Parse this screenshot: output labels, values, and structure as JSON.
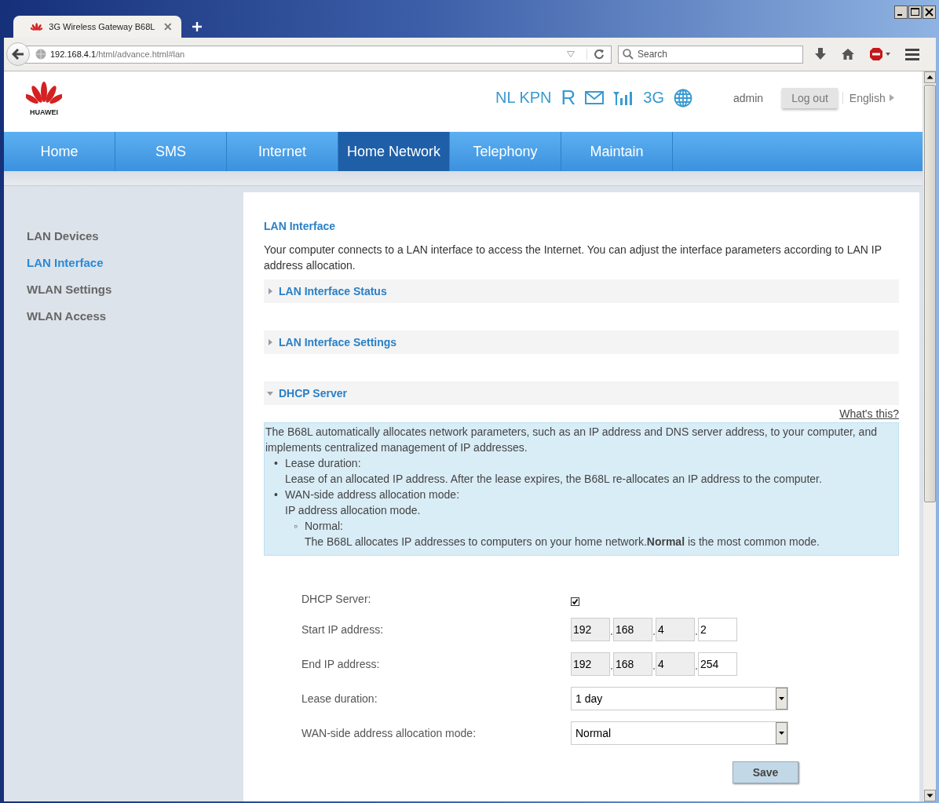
{
  "browser": {
    "tab_title": "3G Wireless Gateway B68L",
    "url_host": "192.168.4.1",
    "url_path": "/html/advance.html#lan",
    "search_placeholder": "Search"
  },
  "header": {
    "operator": "NL KPN",
    "roaming": "R",
    "network_type": "3G",
    "user": "admin",
    "logout": "Log out",
    "language": "English",
    "logo_text": "HUAWEI"
  },
  "menu": [
    {
      "label": "Home",
      "selected": false
    },
    {
      "label": "SMS",
      "selected": false
    },
    {
      "label": "Internet",
      "selected": false
    },
    {
      "label": "Home Network",
      "selected": true
    },
    {
      "label": "Telephony",
      "selected": false
    },
    {
      "label": "Maintain",
      "selected": false
    }
  ],
  "sidebar": {
    "items": [
      {
        "label": "LAN Devices",
        "selected": false
      },
      {
        "label": "LAN Interface",
        "selected": true
      },
      {
        "label": "WLAN Settings",
        "selected": false
      },
      {
        "label": "WLAN Access",
        "selected": false
      }
    ]
  },
  "content": {
    "title": "LAN Interface",
    "intro": "Your computer connects to a LAN interface to access the Internet. You can adjust the interface parameters according to LAN IP address allocation.",
    "sections": [
      {
        "label": "LAN Interface Status",
        "expanded": false
      },
      {
        "label": "LAN Interface Settings",
        "expanded": false
      },
      {
        "label": "DHCP Server",
        "expanded": true
      }
    ],
    "help_link": "What's this?",
    "help": {
      "intro": "The B68L automatically allocates network parameters, such as an IP address and DNS server address, to your computer, and implements centralized management of IP addresses.",
      "items": [
        {
          "marker": "•",
          "term": "Lease duration:",
          "desc": "Lease of an allocated IP address. After the lease expires, the B68L re-allocates an IP address to the computer."
        },
        {
          "marker": "•",
          "term": "WAN-side address allocation mode:",
          "desc": "IP address allocation mode.",
          "children": [
            {
              "marker": "◦",
              "term": "Normal:",
              "desc": "The B68L allocates IP addresses to computers on your home network.**Normal** is the most common mode."
            }
          ]
        }
      ]
    },
    "form": [
      {
        "kind": "checkbox",
        "label": "DHCP Server:",
        "checked": true
      },
      {
        "kind": "ip",
        "label": "Start IP address:",
        "octets": [
          {
            "value": "192",
            "disabled": true
          },
          {
            "value": "168",
            "disabled": true
          },
          {
            "value": "4",
            "disabled": true
          },
          {
            "value": "2",
            "disabled": false
          }
        ]
      },
      {
        "kind": "ip",
        "label": "End IP address:",
        "octets": [
          {
            "value": "192",
            "disabled": true
          },
          {
            "value": "168",
            "disabled": true
          },
          {
            "value": "4",
            "disabled": true
          },
          {
            "value": "254",
            "disabled": false
          }
        ]
      },
      {
        "kind": "select",
        "label": "Lease duration:",
        "value": "1 day"
      },
      {
        "kind": "select",
        "label": "WAN-side address allocation mode:",
        "value": "Normal"
      }
    ],
    "save": "Save"
  }
}
